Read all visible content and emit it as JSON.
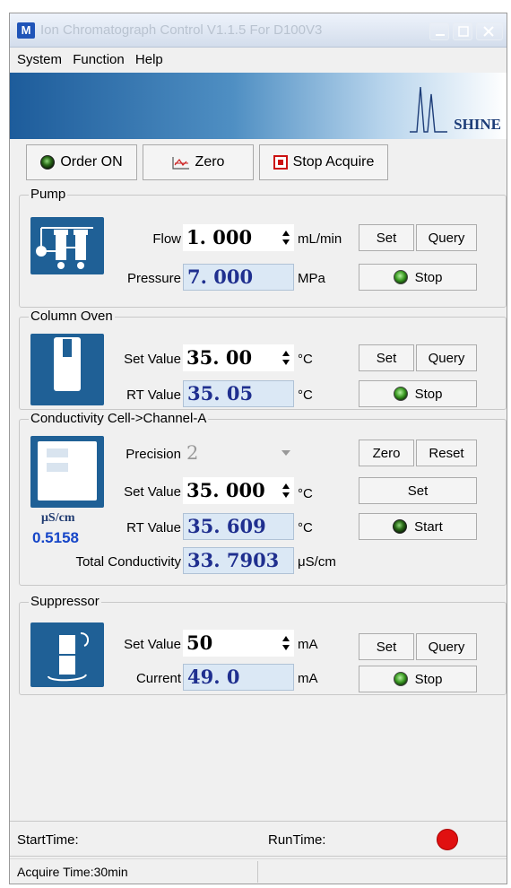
{
  "window": {
    "app_icon": "M",
    "title": "Ion Chromatograph Control V1.1.5 For D100V3",
    "controls": [
      "minimize-icon",
      "maximize-icon",
      "close-icon"
    ]
  },
  "menu": [
    "System",
    "Function",
    "Help"
  ],
  "banner": {
    "logo_text": "SHINE",
    "gradient_color": "#1d5c9b"
  },
  "toolbar": {
    "order_label": "Order ON",
    "zero_label": "Zero",
    "stop_acquire_label": "Stop Acquire"
  },
  "pump": {
    "title": "Pump",
    "flow_label": "Flow",
    "flow_value": "1. 000",
    "flow_unit": "mL/min",
    "pressure_label": "Pressure",
    "pressure_value": "7. 000",
    "pressure_unit": "MPa",
    "set_label": "Set",
    "query_label": "Query",
    "stop_label": "Stop"
  },
  "oven": {
    "title": "Column Oven",
    "set_label": "Set Value",
    "set_value": "35. 00",
    "set_unit": "°C",
    "rt_label": "RT Value",
    "rt_value": "35. 05",
    "rt_unit": "°C",
    "btn_set": "Set",
    "btn_query": "Query",
    "btn_stop": "Stop"
  },
  "cell": {
    "title": "Conductivity Cell->Channel-A",
    "precision_label": "Precision",
    "precision_value": "2",
    "set_label": "Set Value",
    "set_value": "35. 000",
    "set_unit": "°C",
    "rt_label": "RT Value",
    "rt_value": "35. 609",
    "rt_unit": "°C",
    "total_label": "Total Conductivity",
    "total_value": "33. 7903",
    "total_unit": "μS/cm",
    "icon_unit": "μS/cm",
    "icon_value": "0.5158",
    "btn_zero": "Zero",
    "btn_reset": "Reset",
    "btn_set": "Set",
    "btn_start": "Start"
  },
  "suppressor": {
    "title": "Suppressor",
    "set_label": "Set Value",
    "set_value": "50",
    "set_unit": "mA",
    "current_label": "Current",
    "current_value": "49. 0",
    "current_unit": "mA",
    "btn_set": "Set",
    "btn_query": "Query",
    "btn_stop": "Stop"
  },
  "status": {
    "start_time_label": "StartTime:",
    "run_time_label": "RunTime:",
    "indicator_color": "#e01010",
    "acquire_time": "Acquire Time:30min"
  }
}
